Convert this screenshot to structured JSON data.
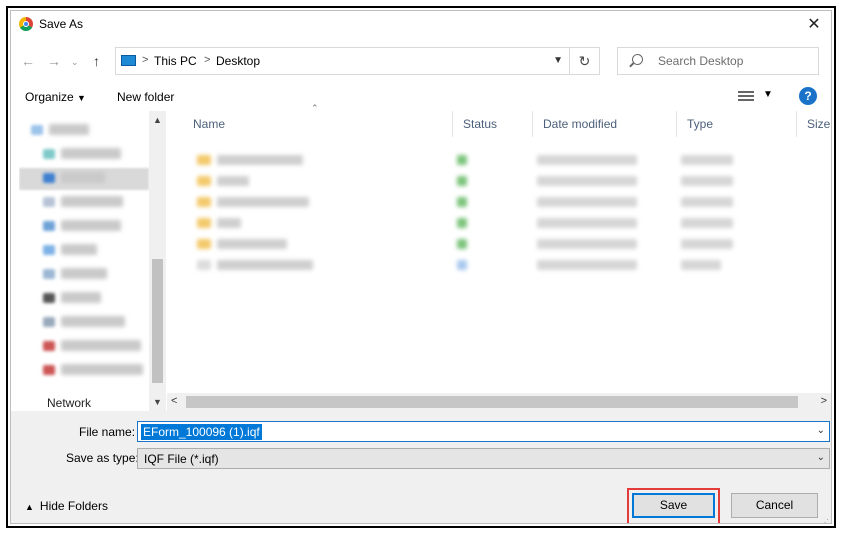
{
  "window": {
    "title": "Save As",
    "close_glyph": "✕",
    "app_icon": "chrome-icon"
  },
  "address": {
    "crumbs": [
      "This PC",
      "Desktop"
    ],
    "separator": ">",
    "search_placeholder": "Search Desktop"
  },
  "toolbar": {
    "organize_label": "Organize",
    "new_folder_label": "New folder",
    "help_glyph": "?"
  },
  "columns": [
    "Name",
    "Status",
    "Date modified",
    "Type",
    "Size"
  ],
  "nav_pane": {
    "network_label": "Network"
  },
  "form": {
    "file_name_label": "File name:",
    "file_name_value": "EForm_100096 (1).iqf",
    "save_type_label": "Save as type:",
    "save_type_value": "IQF File (*.iqf)"
  },
  "footer": {
    "hide_folders_label": "Hide Folders",
    "save_label": "Save",
    "cancel_label": "Cancel"
  },
  "colors": {
    "accent": "#0078d7",
    "highlight": "#e33a3a",
    "help": "#1a73c8"
  }
}
